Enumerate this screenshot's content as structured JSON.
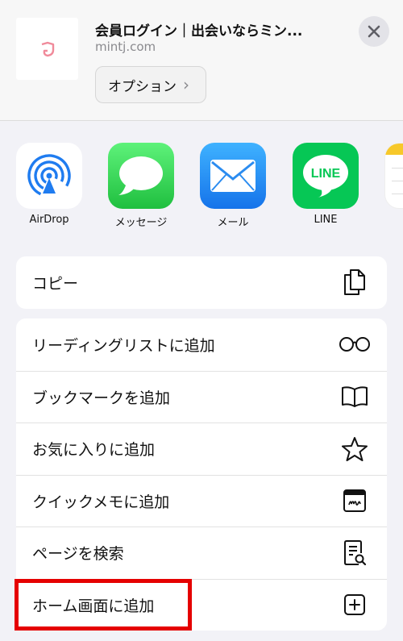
{
  "header": {
    "title": "会員ログイン｜出会いならミン...",
    "url": "mintj.com",
    "options_label": "オプション",
    "options_chevron": "›"
  },
  "apps": [
    {
      "label": "AirDrop",
      "icon": "airdrop-icon"
    },
    {
      "label": "メッセージ",
      "icon": "messages-icon"
    },
    {
      "label": "メール",
      "icon": "mail-icon"
    },
    {
      "label": "LINE",
      "icon": "line-icon",
      "icon_text": "LINE"
    },
    {
      "label": "",
      "icon": "notes-icon"
    }
  ],
  "actions_top": [
    {
      "label": "コピー",
      "icon": "copy-icon"
    }
  ],
  "actions": [
    {
      "label": "リーディングリストに追加",
      "icon": "glasses-icon"
    },
    {
      "label": "ブックマークを追加",
      "icon": "book-icon"
    },
    {
      "label": "お気に入りに追加",
      "icon": "star-icon"
    },
    {
      "label": "クイックメモに追加",
      "icon": "quick-note-icon"
    },
    {
      "label": "ページを検索",
      "icon": "find-on-page-icon"
    },
    {
      "label": "ホーム画面に追加",
      "icon": "add-square-icon"
    }
  ],
  "colors": {
    "highlight": "#e50000",
    "airdrop": "#1f7cf0",
    "messages": "#2ecc4e",
    "mail": "#1a8cf5",
    "line": "#06c755",
    "notes": "#f7c82a"
  }
}
